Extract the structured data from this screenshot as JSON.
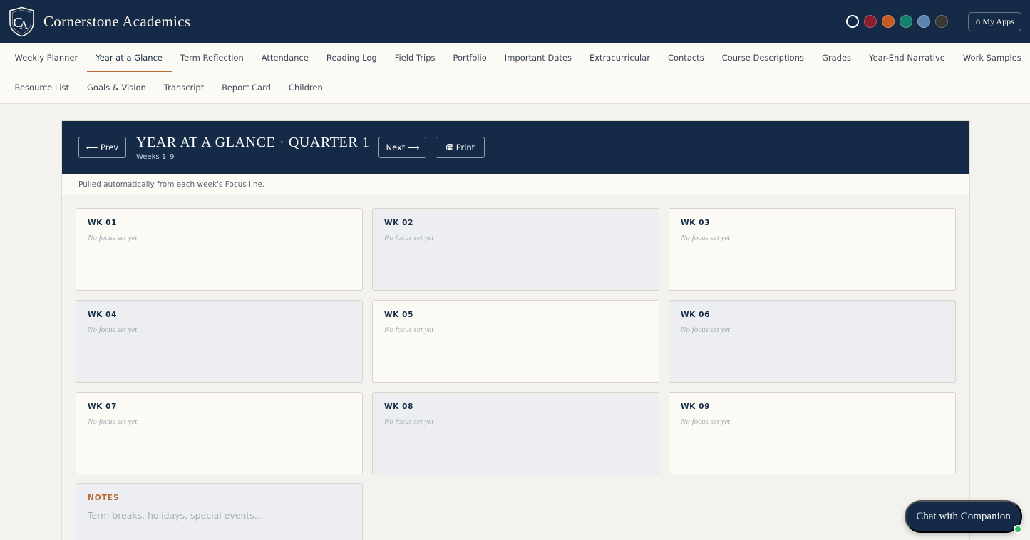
{
  "header": {
    "brand": "Cornerstone Academics",
    "theme_swatches": [
      {
        "name": "ivory",
        "color": "#152a47",
        "active": true
      },
      {
        "name": "crimson",
        "color": "#8b1d2c",
        "active": false
      },
      {
        "name": "rust",
        "color": "#c65a21",
        "active": false
      },
      {
        "name": "teal",
        "color": "#13806c",
        "active": false
      },
      {
        "name": "slate-blue",
        "color": "#5a84ad",
        "active": false
      },
      {
        "name": "charcoal",
        "color": "#3b3733",
        "active": false
      }
    ],
    "my_apps_label": "My Apps"
  },
  "nav": {
    "active": "Year at a Glance",
    "row1": [
      "Weekly Planner",
      "Year at a Glance",
      "Term Reflection",
      "Attendance",
      "Reading Log",
      "Field Trips",
      "Portfolio",
      "Important Dates",
      "Extracurricular",
      "Contacts",
      "Course Descriptions",
      "Grades",
      "Year-End Narrative",
      "Work Samples"
    ],
    "row2": [
      "Resource List",
      "Goals & Vision",
      "Transcript",
      "Report Card",
      "Children"
    ]
  },
  "panel": {
    "prev_label": "⟵ Prev",
    "title": "Year at a Glance · Quarter 1",
    "subtitle": "Weeks 1–9",
    "next_label": "Next ⟶",
    "print_label": "Print",
    "note": "Pulled automatically from each week's Focus line."
  },
  "weeks": [
    {
      "label": "WK 01",
      "focus": "No focus set yet"
    },
    {
      "label": "WK 02",
      "focus": "No focus set yet"
    },
    {
      "label": "WK 03",
      "focus": "No focus set yet"
    },
    {
      "label": "WK 04",
      "focus": "No focus set yet"
    },
    {
      "label": "WK 05",
      "focus": "No focus set yet"
    },
    {
      "label": "WK 06",
      "focus": "No focus set yet"
    },
    {
      "label": "WK 07",
      "focus": "No focus set yet"
    },
    {
      "label": "WK 08",
      "focus": "No focus set yet"
    },
    {
      "label": "WK 09",
      "focus": "No focus set yet"
    }
  ],
  "notes": {
    "label": "NOTES",
    "placeholder": "Term breaks, holidays, special events…",
    "value": ""
  },
  "chat": {
    "label": "Chat with Companion",
    "status_color": "#2fbf5b"
  },
  "colors": {
    "navy": "#152a47",
    "accent": "#b36b33",
    "cream": "#fcfaf5"
  }
}
